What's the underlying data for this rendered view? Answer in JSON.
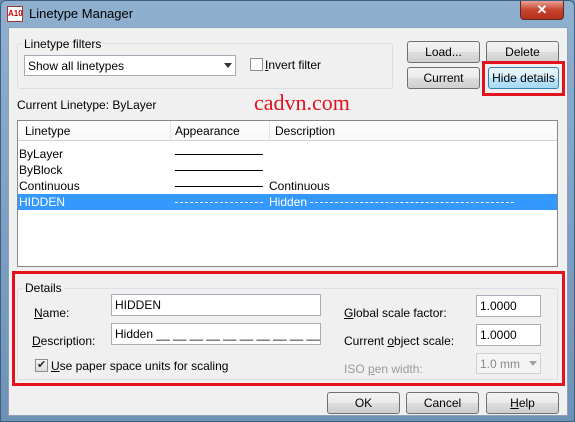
{
  "window": {
    "title": "Linetype Manager",
    "app_icon_text": "A10",
    "close_glyph": "✕"
  },
  "filters": {
    "group_label": "Linetype filters",
    "selected": "Show all linetypes",
    "invert_label": "Invert filter",
    "invert_checked": false
  },
  "buttons": {
    "load": "Load...",
    "delete": "Delete",
    "current": "Current",
    "hide_details": "Hide details",
    "ok": "OK",
    "cancel": "Cancel",
    "help": "Help"
  },
  "current_linetype": {
    "label": "Current Linetype:",
    "value": "ByLayer"
  },
  "watermark": "cadvn.com",
  "list": {
    "columns": [
      "Linetype",
      "Appearance",
      "Description"
    ],
    "rows": [
      {
        "name": "ByLayer",
        "appearance": "solid",
        "description": ""
      },
      {
        "name": "ByBlock",
        "appearance": "solid",
        "description": ""
      },
      {
        "name": "Continuous",
        "appearance": "solid",
        "description": "Continuous"
      },
      {
        "name": "HIDDEN",
        "appearance": "dashed",
        "description": "Hidden",
        "selected": true
      }
    ]
  },
  "details": {
    "group_label": "Details",
    "name_label": "Name:",
    "name_value": "HIDDEN",
    "description_label": "Description:",
    "description_value": "Hidden __ __ __ __ __ __ __ __ __ __ __ __ __ __ __ __",
    "paper_space_label": "Use paper space units for scaling",
    "paper_space_checked": true,
    "global_scale_label": "Global scale factor:",
    "global_scale_value": "1.0000",
    "object_scale_label": "Current object scale:",
    "object_scale_value": "1.0000",
    "iso_pen_label": "ISO pen width:",
    "iso_pen_value": "1.0 mm"
  },
  "colors": {
    "highlight": "#3399ff",
    "annotation_red": "#e2121f"
  }
}
